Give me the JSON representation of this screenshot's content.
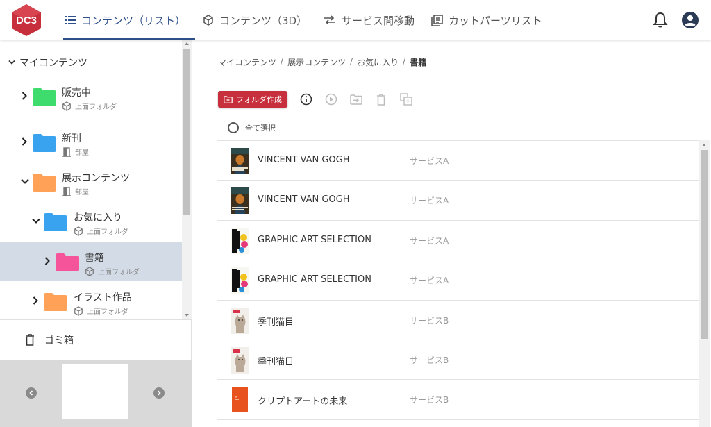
{
  "app": {
    "logo_text": "DC3",
    "brand_color": "#c62f3b",
    "accent_color": "#2d4f8a"
  },
  "nav": {
    "tabs": [
      {
        "label": "コンテンツ（リスト）",
        "icon": "list-icon",
        "active": true
      },
      {
        "label": "コンテンツ（3D）",
        "icon": "cube-icon",
        "active": false
      },
      {
        "label": "サービス間移動",
        "icon": "swap-arrows-icon",
        "active": false
      },
      {
        "label": "カットパーツリスト",
        "icon": "document-list-icon",
        "active": false
      }
    ],
    "notifications_icon": "bell-icon",
    "account_icon": "account-circle-icon"
  },
  "sidebar": {
    "root_label": "マイコンテンツ",
    "nodes": [
      {
        "name": "販売中",
        "sub": "上面フォルダ",
        "sub_icon": "cube-icon",
        "folder_color": "#3ddc6c",
        "expanded": false
      },
      {
        "name": "新刊",
        "sub": "部屋",
        "sub_icon": "door-icon",
        "folder_color": "#3aa3ef",
        "expanded": false
      },
      {
        "name": "展示コンテンツ",
        "sub": "部屋",
        "sub_icon": "door-icon",
        "folder_color": "#ffa257",
        "expanded": true
      },
      {
        "name": "お気に入り",
        "sub": "上面フォルダ",
        "sub_icon": "cube-icon",
        "folder_color": "#3aa3ef",
        "expanded": true
      },
      {
        "name": "書籍",
        "sub": "上面フォルダ",
        "sub_icon": "cube-icon",
        "folder_color": "#f5549a",
        "expanded": false,
        "selected": true
      },
      {
        "name": "イラスト作品",
        "sub": "上面フォルダ",
        "sub_icon": "cube-icon",
        "folder_color": "#ffa257",
        "expanded": false
      }
    ],
    "trash_label": "ゴミ箱"
  },
  "breadcrumb": [
    "マイコンテンツ",
    "展示コンテンツ",
    "お気に入り",
    "書籍"
  ],
  "toolbar": {
    "create_folder_label": "フォルダ作成",
    "icons": [
      "info-icon",
      "play-icon",
      "move-to-folder-icon",
      "delete-icon",
      "copy-icon"
    ]
  },
  "list": {
    "select_all_label": "全て選択",
    "rows": [
      {
        "title": "VINCENT VAN GOGH",
        "service": "サービスA",
        "thumb": "vangogh"
      },
      {
        "title": "VINCENT VAN GOGH",
        "service": "サービスA",
        "thumb": "vangogh"
      },
      {
        "title": "GRAPHIC ART SELECTION",
        "service": "サービスA",
        "thumb": "graphic"
      },
      {
        "title": "GRAPHIC ART SELECTION",
        "service": "サービスA",
        "thumb": "graphic"
      },
      {
        "title": "季刊猫目",
        "service": "サービスB",
        "thumb": "cat"
      },
      {
        "title": "季刊猫目",
        "service": "サービスB",
        "thumb": "cat"
      },
      {
        "title": "クリプトアートの未来",
        "service": "サービスB",
        "thumb": "orange"
      }
    ]
  }
}
